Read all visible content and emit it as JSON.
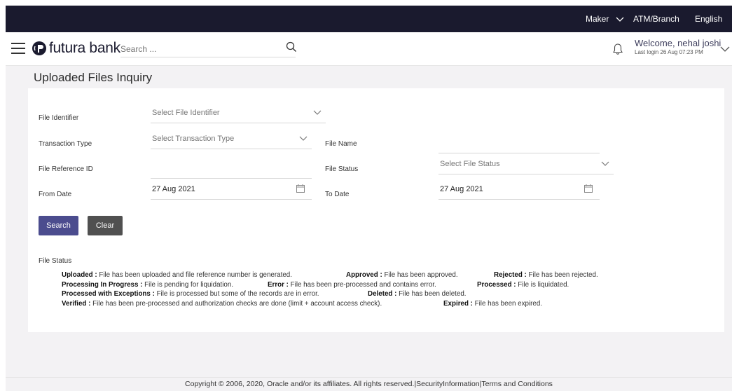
{
  "topbar": {
    "role": "Maker",
    "location": "ATM/Branch",
    "language": "English"
  },
  "header": {
    "brand": "futura bank",
    "search_placeholder": "Search ...",
    "welcome": "Welcome, nehal joshi",
    "last_login": "Last login 26 Aug 07:23 PM"
  },
  "page": {
    "title": "Uploaded Files Inquiry"
  },
  "form": {
    "file_identifier_label": "File Identifier",
    "file_identifier_placeholder": "Select File Identifier",
    "transaction_type_label": "Transaction Type",
    "transaction_type_placeholder": "Select Transaction Type",
    "file_name_label": "File Name",
    "file_name_value": "",
    "file_reference_label": "File Reference ID",
    "file_reference_value": "",
    "file_status_label": "File Status",
    "file_status_placeholder": "Select File Status",
    "from_date_label": "From Date",
    "from_date_value": "27 Aug 2021",
    "to_date_label": "To Date",
    "to_date_value": "27 Aug 2021",
    "search_label": "Search",
    "clear_label": "Clear"
  },
  "status_legend": {
    "heading": "File Status",
    "rows": [
      [
        {
          "term": "Uploaded :",
          "desc": " File has been uploaded and file reference number is generated."
        },
        {
          "term": "Approved :",
          "desc": " File has been approved."
        },
        {
          "term": "Rejected :",
          "desc": " File has been rejected."
        }
      ],
      [
        {
          "term": "Processing In Progress :",
          "desc": " File is pending for liquidation."
        },
        {
          "term": "Error :",
          "desc": " File has been pre-processed and contains error."
        },
        {
          "term": "Processed :",
          "desc": " File is liquidated."
        }
      ],
      [
        {
          "term": "Processed with Exceptions :",
          "desc": " File is processed but some of the records are in error."
        },
        {
          "term": "Deleted :",
          "desc": " File has been deleted."
        }
      ],
      [
        {
          "term": "Verified :",
          "desc": " File has been pre-processed and authorization checks are done (limit + account access check)."
        },
        {
          "term": "Expired :",
          "desc": " File has been expired."
        }
      ]
    ]
  },
  "footer": {
    "copyright": "Copyright © 2006, 2020, Oracle and/or its affiliates. All rights reserved.",
    "security": "SecurityInformation",
    "terms": "Terms and Conditions"
  },
  "colors": {
    "topbar": "#1a1a2e",
    "primary_button": "#4b4c8e",
    "secondary_button": "#505050"
  }
}
